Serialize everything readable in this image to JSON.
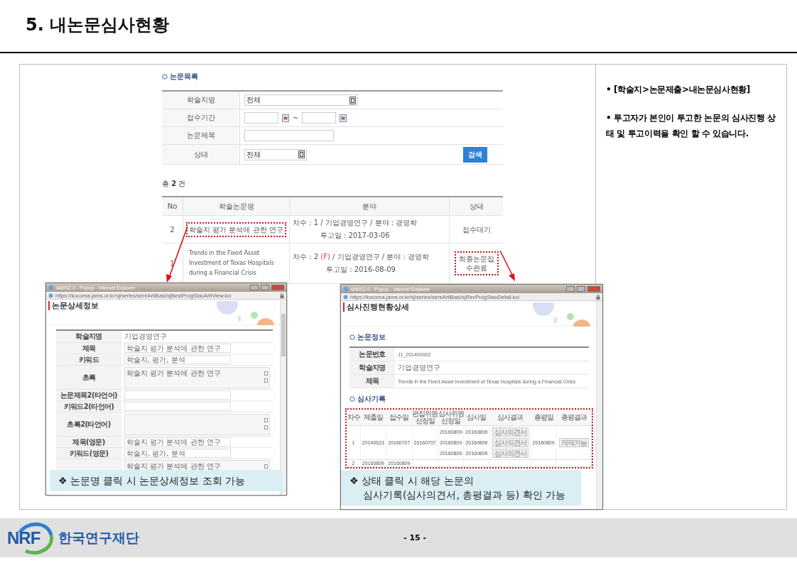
{
  "page_title": "5. 내논문심사현황",
  "search_panel": {
    "heading": "논문목록",
    "fields": [
      {
        "label": "학술지명",
        "kind": "select",
        "value": "전체"
      },
      {
        "label": "접수기간",
        "kind": "daterange",
        "separator": "~"
      },
      {
        "label": "논문제목",
        "kind": "text"
      },
      {
        "label": "상태",
        "kind": "select",
        "value": "전체"
      }
    ],
    "search_button": "검색"
  },
  "result_count": "총 **2** 건",
  "results_table": {
    "columns": [
      "No",
      "학술논문명",
      "분야",
      "상태"
    ],
    "rows": [
      {
        "no": "2",
        "title": "학술지 평가 분석에 관한 연구",
        "round": "차수 : 1",
        "flag": "",
        "field": " / 기업경영연구 / 분야 : 경영학",
        "date": "투고일 : 2017-03-06",
        "status": "접수대기",
        "title_highlighted": true,
        "status_highlighted": false
      },
      {
        "no": "1",
        "title": "Trends in the Fixed Asset Investment of Texas Hospitals during a Financial Crisis",
        "round": "차수 : 2",
        "flag": "(F)",
        "field": " / 기업경영연구 / 분야 : 경영학",
        "date": "투고일 : 2016-08-09",
        "status": "최종논문접수완료",
        "title_highlighted": false,
        "status_highlighted": true
      }
    ]
  },
  "detail_popup": {
    "window_title": "IAMS2.0 - Popup - Internet Explorer",
    "url": "https://kocoma.jams.or.kr/sj/series/sereArtiBasi/sjBestProgStauArtiView.kci",
    "heading": "논문상세정보",
    "rows": [
      {
        "label": "학술지명",
        "kind": "plain",
        "value": "기업경영연구"
      },
      {
        "label": "제목",
        "kind": "input",
        "value": "학술지 평가 분석에 관한 연구"
      },
      {
        "label": "키워드",
        "kind": "input",
        "value": "학술지, 평가, 분석"
      },
      {
        "label": "초록",
        "kind": "textarea",
        "value": "학술지 평가 분석에 관한 연구"
      },
      {
        "label": "논문제목2(타언어)",
        "kind": "input"
      },
      {
        "label": "키워드2(타언어)",
        "kind": "input"
      },
      {
        "label": "초록2(타언어)",
        "kind": "textarea"
      },
      {
        "label": "제목(영문)",
        "kind": "input",
        "value": "학술지 평가 분석에 관한 연구"
      },
      {
        "label": "키워드(영문)",
        "kind": "input",
        "value": "학술지, 평가, 분석"
      },
      {
        "kind": "textarea",
        "value": "학술지 평가 분석에 관한 연구"
      }
    ]
  },
  "review_popup": {
    "window_title": "IAMS2.0 - Popup - Internet Explorer",
    "url": "https://kocoma.jams.or.kr/sj/series/sereArtiBasi/sjRevProgStauDetail.kci",
    "heading": "심사진행현황상세",
    "info_heading": "논문정보",
    "info_rows": [
      {
        "label": "논문번호",
        "value": "J1_201400002"
      },
      {
        "label": "학술지명",
        "value": "기업경영연구"
      },
      {
        "label": "제목",
        "value": "Trends in the Fixed Asset Investment of Texas Hospitals during a Financial Crisis"
      }
    ],
    "record_heading": "심사기록",
    "record_highlighted": true,
    "record_columns": [
      "차수",
      "제출일",
      "접수일",
      "편집위원선정일",
      "심사위원선정일",
      "심사일",
      "심사결과",
      "총평일",
      "총평결과"
    ],
    "record_rows": [
      {
        "round": "1",
        "submitted": "20140623",
        "received": "20160707",
        "editor_assigned": "20160707",
        "reviews": [
          {
            "assigned": "20160809",
            "reviewed": "20160809",
            "result": "심사의견서"
          },
          {
            "assigned": "20160809",
            "reviewed": "20160809",
            "result": "심사의견서"
          },
          {
            "assigned": "20160809",
            "reviewed": "20160809",
            "result": "심사의견서"
          }
        ],
        "summary_date": "20160809",
        "summary_result": "게재가능"
      },
      {
        "round": "2",
        "submitted": "20160809",
        "received": "20160809",
        "reviews": []
      }
    ]
  },
  "captions": [
    [
      "❖ 논문명 클릭 시 논문상세정보 조회 가능"
    ],
    [
      "❖ 상태 클릭 시 해당 논문의",
      "심사기록(심사의견서, 총평결과 등) 확인 가능"
    ]
  ],
  "notes": [
    "• [학술지>논문제출>내논문심사현황]",
    "• 투고자가 본인이 투고한 논문의 심사진행 상태 및 투고이력을 확인 할 수 있습니다."
  ],
  "footer": {
    "logo": "NRF",
    "organization": "한국연구재단",
    "page_number": "- 15 -"
  }
}
